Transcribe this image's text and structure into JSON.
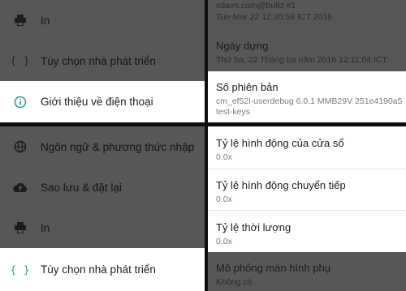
{
  "left_top": {
    "items": [
      {
        "label": "In",
        "icon": "printer-icon"
      },
      {
        "label": "Tùy chọn nhà phát triển",
        "icon": "developer-braces-icon"
      },
      {
        "label": "Giới thiệu về điện thoại",
        "icon": "info-icon"
      }
    ]
  },
  "left_bottom": {
    "items": [
      {
        "label": "Ngôn ngữ & phương thức nhập",
        "icon": "globe-icon"
      },
      {
        "label": "Sao lưu & đặt lại",
        "icon": "cloud-upload-icon"
      },
      {
        "label": "In",
        "icon": "printer-icon"
      },
      {
        "label": "Tùy chọn nhà phát triển",
        "icon": "developer-braces-icon"
      }
    ]
  },
  "right_top": {
    "build_line1": "xdavn.com@build #1",
    "build_line2": "Tue Mar 22 12:20:59 ICT 2016",
    "build_date": {
      "title": "Ngày dựng",
      "value": "Thứ ba, 22 Tháng ba năm 2016 12:11:04 ICT"
    },
    "build_number": {
      "title": "Số phiên bản",
      "value_line1": "cm_ef52l-userdebug 6.0.1 MMB29V 251e4190a5",
      "value_line2": "test-keys"
    }
  },
  "right_bottom": {
    "items": [
      {
        "title": "Tỷ lệ hình động của cửa sổ",
        "value": "0.0x"
      },
      {
        "title": "Tỷ lệ hình động chuyển tiếp",
        "value": "0.0x"
      },
      {
        "title": "Tỷ lệ thời lượng",
        "value": "0.0x"
      },
      {
        "title": "Mô phỏng màn hình phụ",
        "value": "Không có"
      }
    ]
  },
  "colors": {
    "dim_overlay": "#575757",
    "highlight": "#ffffff",
    "accent": "#1f9d8c",
    "divider": "#0e0e0e"
  }
}
